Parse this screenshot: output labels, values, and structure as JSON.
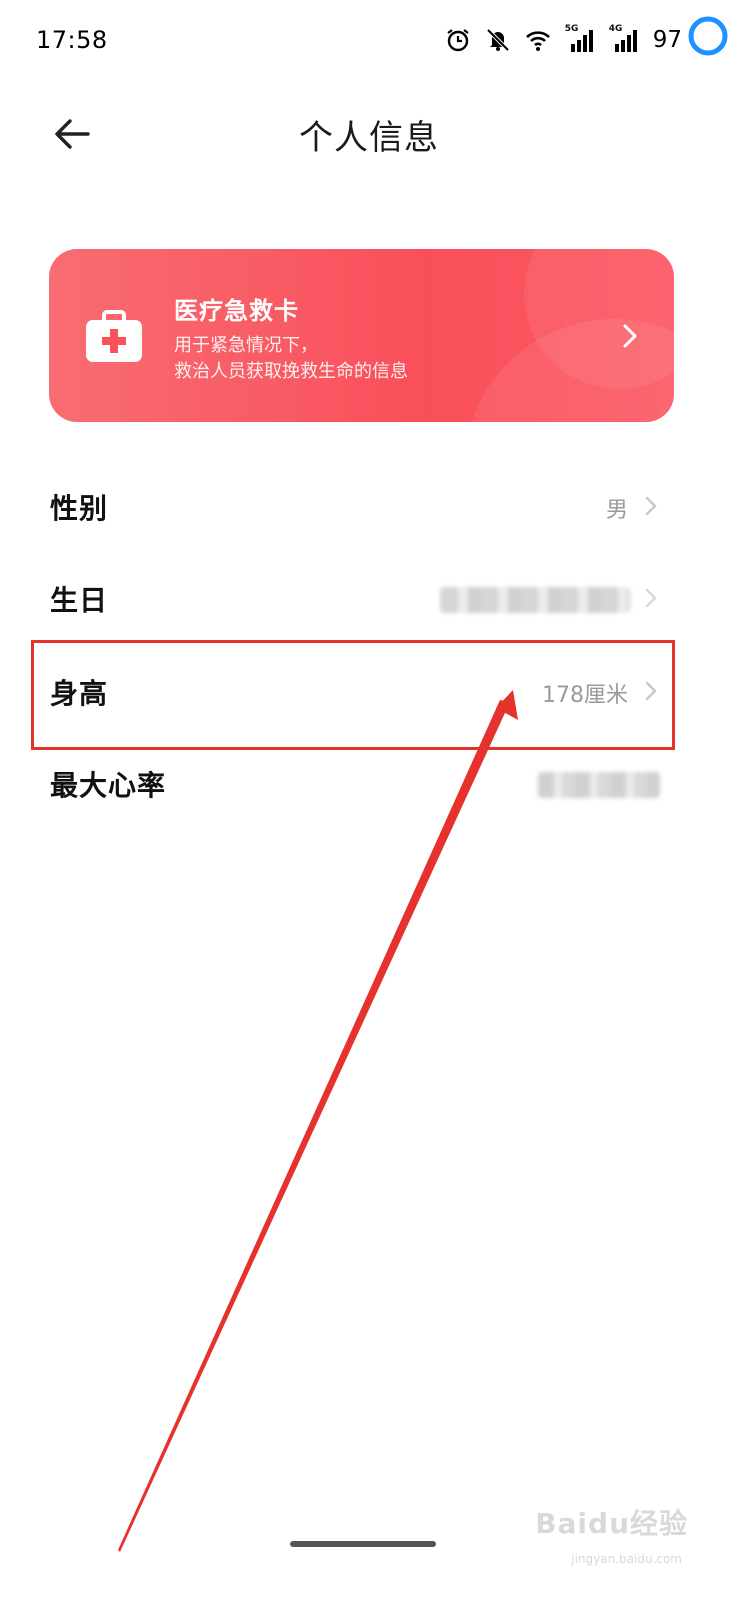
{
  "status_bar": {
    "time": "17:58",
    "signal1_tag": "5G",
    "signal2_tag": "4G",
    "battery_level": "97",
    "icons": [
      "alarm-icon",
      "mute-icon",
      "wifi-icon",
      "signal-5g-icon",
      "signal-4g-icon",
      "battery-ring-icon"
    ]
  },
  "header": {
    "title": "个人信息",
    "back_icon": "back-arrow-icon"
  },
  "emergency_card": {
    "title": "医疗急救卡",
    "description_line1": "用于紧急情况下，",
    "description_line2": "救治人员获取挽救生命的信息",
    "icon": "first-aid-kit-icon",
    "colors": {
      "gradient_start": "#f86d72",
      "gradient_end": "#f94f5b"
    }
  },
  "profile_rows": [
    {
      "label": "性别",
      "value": "男"
    },
    {
      "label": "生日",
      "value": ""
    },
    {
      "label": "身高",
      "value": "178厘米"
    },
    {
      "label": "最大心率",
      "value": ""
    }
  ],
  "annotation": {
    "highlight_color": "#e5322d"
  },
  "watermark": {
    "text": "Baidu经验",
    "sub": "jingyan.baidu.com"
  }
}
